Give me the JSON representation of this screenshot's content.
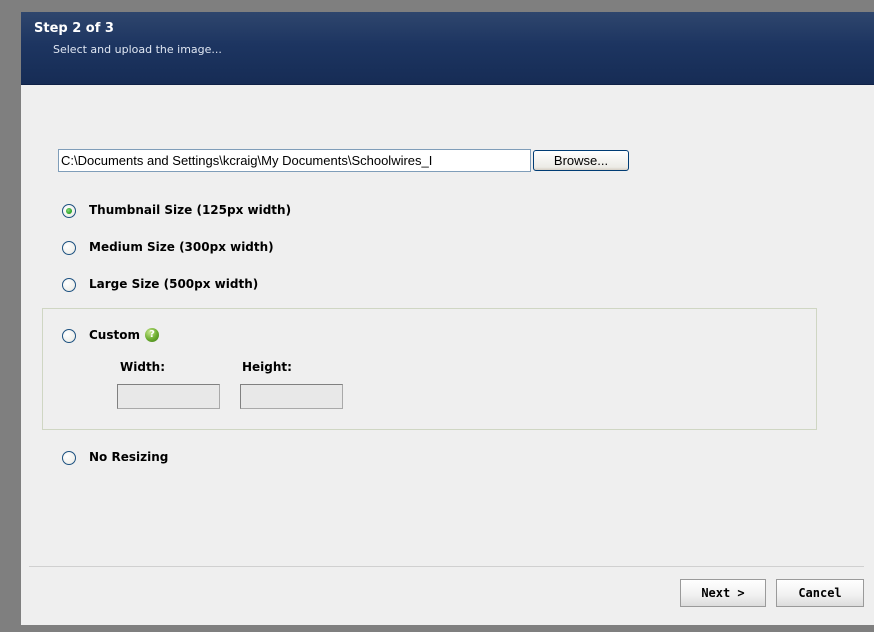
{
  "header": {
    "step_title": "Step 2 of 3",
    "step_subtitle": "Select and upload the image..."
  },
  "file_upload": {
    "path_value": "C:\\Documents and Settings\\kcraig\\My Documents\\Schoolwires_I",
    "browse_label": "Browse..."
  },
  "size_options": [
    {
      "label": "Thumbnail Size (125px width)",
      "selected": true
    },
    {
      "label": "Medium Size (300px width)",
      "selected": false
    },
    {
      "label": "Large Size (500px width)",
      "selected": false
    }
  ],
  "custom": {
    "label": "Custom",
    "help_icon": "question-icon",
    "width_label": "Width:",
    "height_label": "Height:",
    "width_value": "",
    "height_value": ""
  },
  "no_resizing": {
    "label": "No Resizing"
  },
  "footer": {
    "next_label": "Next >",
    "cancel_label": "Cancel"
  },
  "colors": {
    "header_bg": "#1d3561",
    "dialog_bg": "#efefef",
    "radio_selected": "#21a121"
  }
}
